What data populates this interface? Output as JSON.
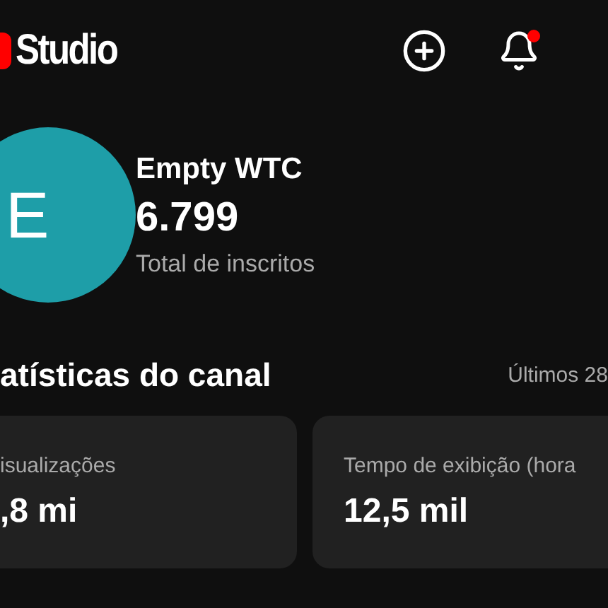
{
  "header": {
    "logo_text": "Studio",
    "notifications": {
      "unread": true
    }
  },
  "channel": {
    "avatar_letter": "E",
    "name": "Empty WTC",
    "subscribers": "6.799",
    "subscribers_label": "Total de inscritos"
  },
  "stats": {
    "title": "atísticas do canal",
    "period": "Últimos 28",
    "cards": [
      {
        "label": "isualizações",
        "value": ",8 mi"
      },
      {
        "label": "Tempo de exibição (hora",
        "value": "12,5 mil"
      }
    ]
  }
}
